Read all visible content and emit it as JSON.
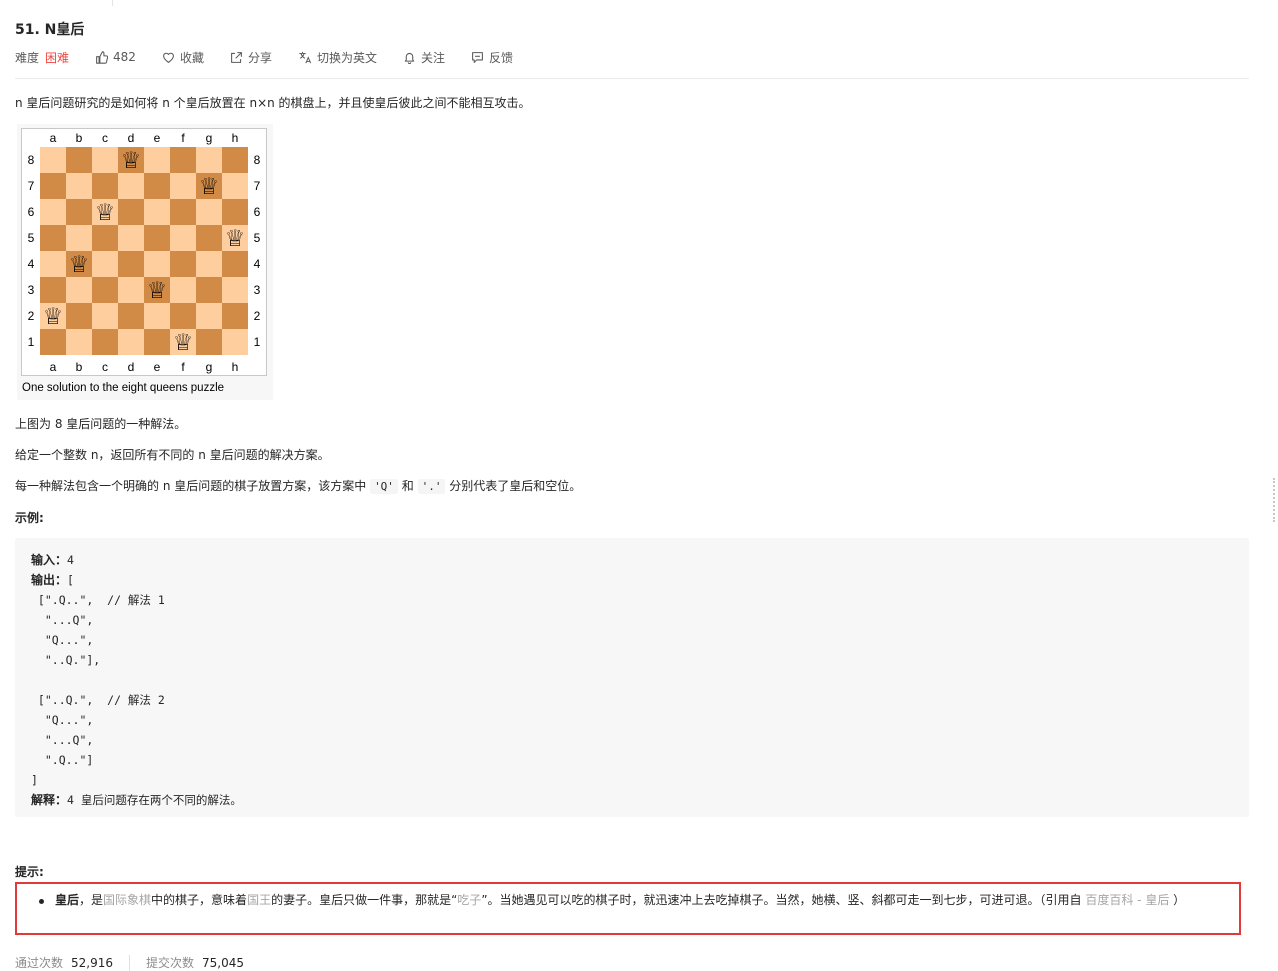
{
  "problem": {
    "title": "51. N皇后",
    "difficulty_label": "难度",
    "difficulty_value": "困难",
    "likes": "482",
    "favorite": "收藏",
    "share": "分享",
    "switch_lang": "切换为英文",
    "follow": "关注",
    "feedback": "反馈"
  },
  "description": {
    "intro": "n 皇后问题研究的是如何将 n 个皇后放置在 n×n 的棋盘上，并且使皇后彼此之间不能相互攻击。",
    "figure_caption": "One solution to the eight queens puzzle",
    "board_files": [
      "a",
      "b",
      "c",
      "d",
      "e",
      "f",
      "g",
      "h"
    ],
    "board_ranks": [
      "8",
      "7",
      "6",
      "5",
      "4",
      "3",
      "2",
      "1"
    ],
    "queens": [
      "d8",
      "g7",
      "c6",
      "h5",
      "b4",
      "e3",
      "a2",
      "f1"
    ],
    "queen_glyph": "♕",
    "light_square_color": "#ffce9e",
    "dark_square_color": "#d18b47",
    "line1": "上图为 8 皇后问题的一种解法。",
    "line2": "给定一个整数 n，返回所有不同的 n 皇后问题的解决方案。",
    "line3_a": "每一种解法包含一个明确的 n 皇后问题的棋子放置方案，该方案中 ",
    "code_q": "'Q'",
    "line3_and": " 和 ",
    "code_dot": "'.'",
    "line3_b": " 分别代表了皇后和空位。",
    "example_heading": "示例:"
  },
  "example": {
    "input_label": "输入：",
    "input_value": "4",
    "output_label": "输出：",
    "output_lines": [
      "[",
      " [\".Q..\",  // 解法 1",
      "  \"...Q\",",
      "  \"Q...\",",
      "  \"..Q.\"],",
      "",
      " [\"..Q.\",  // 解法 2",
      "  \"Q...\",",
      "  \"...Q\",",
      "  \".Q..\"]",
      "]"
    ],
    "explain_label": "解释：",
    "explain_value": "4 皇后问题存在两个不同的解法。"
  },
  "hint": {
    "heading": "提示:",
    "term": "皇后",
    "t1": "，是",
    "link1": "国际象棋",
    "t2": "中的棋子，意味着",
    "link2": "国王",
    "t3": "的妻子。皇后只做一件事，那就是“",
    "link3": "吃子",
    "t4": "”。当她遇见可以吃的棋子时，就迅速冲上去吃掉棋子。当然，她横、竖、斜都可走一到七步，可进可退。（引用自 ",
    "link4": "百度百科 - 皇后",
    "t5": " ）"
  },
  "stats": {
    "accepted_label": "通过次数",
    "accepted_value": "52,916",
    "submitted_label": "提交次数",
    "submitted_value": "75,045"
  },
  "colors": {
    "accent_hard": "#ef4743",
    "highlight_border": "#e03a3a",
    "code_bg": "#f7f7f7"
  }
}
